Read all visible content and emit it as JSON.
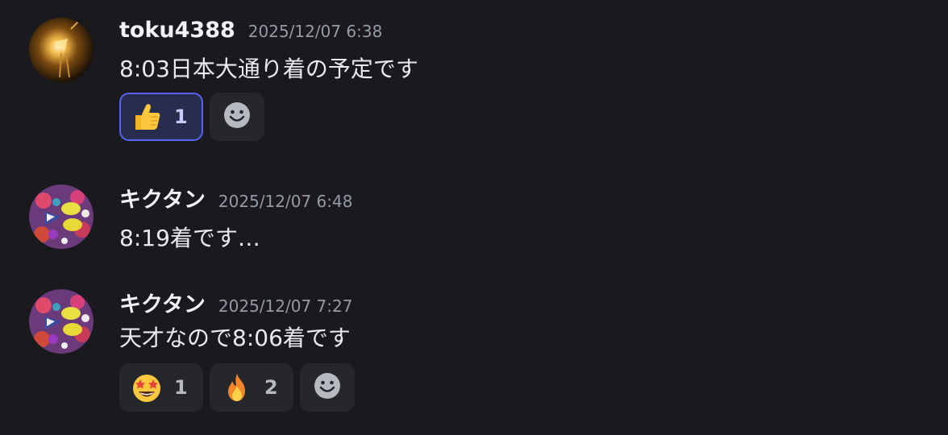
{
  "messages": [
    {
      "username": "toku4388",
      "timestamp": "2025/12/07 6:38",
      "content": "8:03日本大通り着の予定です",
      "reactions": [
        {
          "emoji": "thumbs-up",
          "count": "1",
          "active": true
        }
      ]
    },
    {
      "username": "キクタン",
      "timestamp": "2025/12/07 6:48",
      "content": "8:19着です…",
      "reactions": []
    },
    {
      "username": "キクタン",
      "timestamp": "2025/12/07 7:27",
      "content": "天才なので8:06着です",
      "reactions": [
        {
          "emoji": "star-struck",
          "count": "1",
          "active": false
        },
        {
          "emoji": "fire",
          "count": "2",
          "active": false
        }
      ]
    }
  ],
  "colors": {
    "background": "#1a1a1e",
    "reaction_bg": "#26272b",
    "reaction_active_border": "#5865f2",
    "timestamp": "#949ba4"
  }
}
